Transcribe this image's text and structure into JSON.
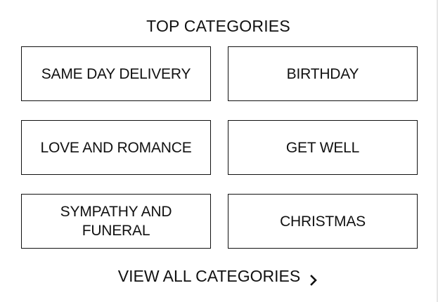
{
  "section": {
    "title": "TOP CATEGORIES",
    "categories": [
      {
        "label": "SAME DAY DELIVERY"
      },
      {
        "label": "BIRTHDAY"
      },
      {
        "label": "LOVE AND ROMANCE"
      },
      {
        "label": "GET WELL"
      },
      {
        "label": "SYMPATHY AND FUNERAL"
      },
      {
        "label": "CHRISTMAS"
      }
    ],
    "view_all_label": "VIEW ALL CATEGORIES",
    "view_all_icon": "chevron-right-icon"
  }
}
